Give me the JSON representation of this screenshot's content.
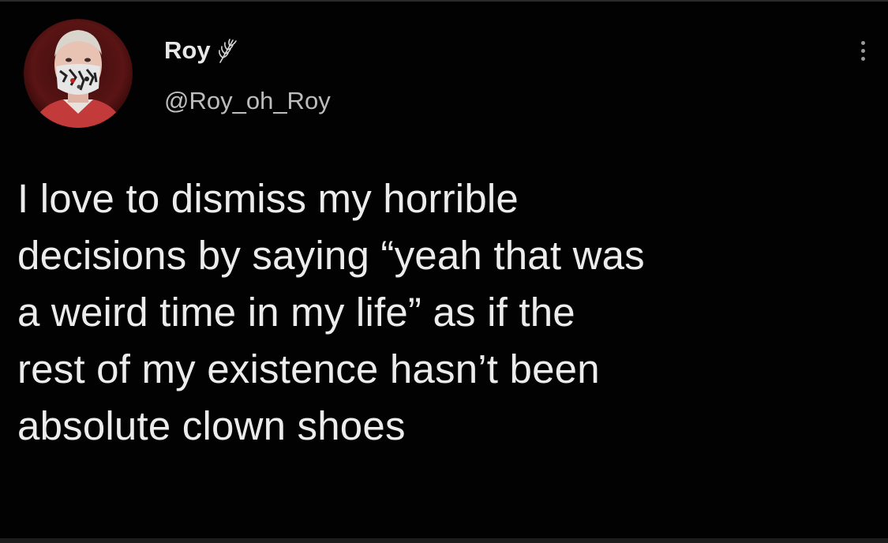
{
  "tweet": {
    "author": {
      "display_name": "Roy",
      "handle": "@Roy_oh_Roy",
      "badge_icon": "wheat-sprig-icon",
      "avatar_icon": "profile-photo-avatar"
    },
    "more_icon": "vertical-ellipsis-icon",
    "text_lines": [
      "I love to dismiss my horrible",
      "decisions by saying “yeah that was",
      "a weird time in my life” as if the",
      "rest of my existence hasn’t been",
      "absolute clown shoes"
    ]
  },
  "colors": {
    "background": "#020202",
    "primary_text": "#ececec",
    "secondary_text": "#bdbdbd"
  }
}
